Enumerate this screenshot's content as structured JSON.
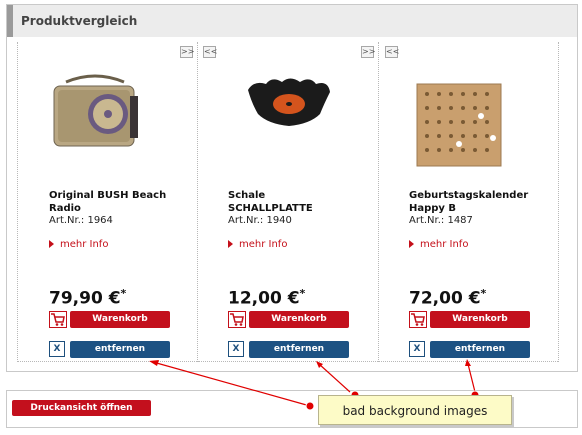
{
  "panel": {
    "title": "Produktvergleich"
  },
  "products": [
    {
      "name_line1": "Original BUSH Beach",
      "name_line2": "Radio",
      "artnr": "Art.Nr.: 1964",
      "more_info": "mehr Info",
      "price": "79,90 €",
      "price_star": "*",
      "cart_label": "Warenkorb",
      "remove_label": "entfernen",
      "image_icon": "radio-image",
      "nav": [
        ">>"
      ]
    },
    {
      "name_line1": "Schale",
      "name_line2": "SCHALLPLATTE",
      "artnr": "Art.Nr.: 1940",
      "more_info": "mehr Info",
      "price": "12,00 €",
      "price_star": "*",
      "cart_label": "Warenkorb",
      "remove_label": "entfernen",
      "image_icon": "record-bowl-image",
      "nav": [
        "<<",
        ">>"
      ]
    },
    {
      "name_line1": "Geburtstagskalender",
      "name_line2": "Happy B",
      "artnr": "Art.Nr.: 1487",
      "more_info": "mehr Info",
      "price": "72,00 €",
      "price_star": "*",
      "cart_label": "Warenkorb",
      "remove_label": "entfernen",
      "image_icon": "peg-calendar-image",
      "nav": [
        "<<"
      ]
    }
  ],
  "footer": {
    "print_label": "Druckansicht öffnen"
  },
  "annotation": {
    "text": "bad background images"
  },
  "colors": {
    "red": "#c3101d",
    "blue": "#1d5283",
    "callout": "#fdfbc7"
  }
}
